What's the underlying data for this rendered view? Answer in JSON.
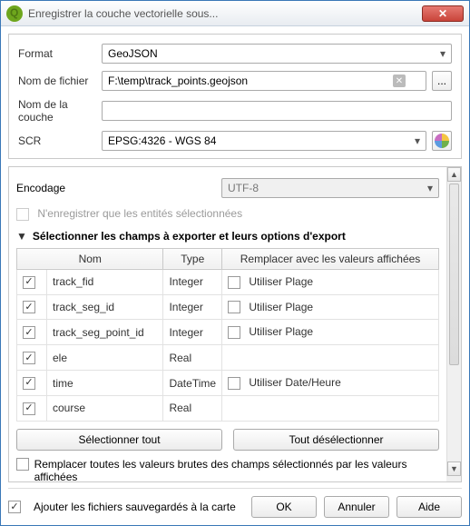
{
  "title": "Enregistrer la couche vectorielle sous...",
  "form": {
    "format_label": "Format",
    "format_value": "GeoJSON",
    "file_label": "Nom de fichier",
    "file_value": "F:\\temp\\track_points.geojson",
    "browse": "...",
    "layer_label": "Nom de la couche",
    "layer_value": "",
    "scr_label": "SCR",
    "scr_value": "EPSG:4326 - WGS 84"
  },
  "encoding": {
    "label": "Encodage",
    "value": "UTF-8"
  },
  "save_selected": "N'enregistrer que les entités sélectionnées",
  "section_fields": "Sélectionner les champs à exporter et leurs options d'export",
  "table": {
    "headers": {
      "name": "Nom",
      "type": "Type",
      "replace": "Remplacer avec les valeurs affichées"
    },
    "rows": [
      {
        "checked": true,
        "name": "track_fid",
        "type": "Integer",
        "opt_check": false,
        "opt_label": "Utiliser Plage"
      },
      {
        "checked": true,
        "name": "track_seg_id",
        "type": "Integer",
        "opt_check": false,
        "opt_label": "Utiliser Plage"
      },
      {
        "checked": true,
        "name": "track_seg_point_id",
        "type": "Integer",
        "opt_check": false,
        "opt_label": "Utiliser Plage"
      },
      {
        "checked": true,
        "name": "ele",
        "type": "Real",
        "opt_check": null,
        "opt_label": ""
      },
      {
        "checked": true,
        "name": "time",
        "type": "DateTime",
        "opt_check": false,
        "opt_label": "Utiliser Date/Heure"
      },
      {
        "checked": true,
        "name": "course",
        "type": "Real",
        "opt_check": null,
        "opt_label": ""
      }
    ]
  },
  "buttons": {
    "select_all": "Sélectionner tout",
    "deselect_all": "Tout désélectionner"
  },
  "replace_all": "Remplacer toutes les valeurs brutes des champs sélectionnés par les valeurs affichées",
  "footer": {
    "add_saved": "Ajouter les fichiers sauvegardés à la carte",
    "ok": "OK",
    "cancel": "Annuler",
    "help": "Aide"
  }
}
